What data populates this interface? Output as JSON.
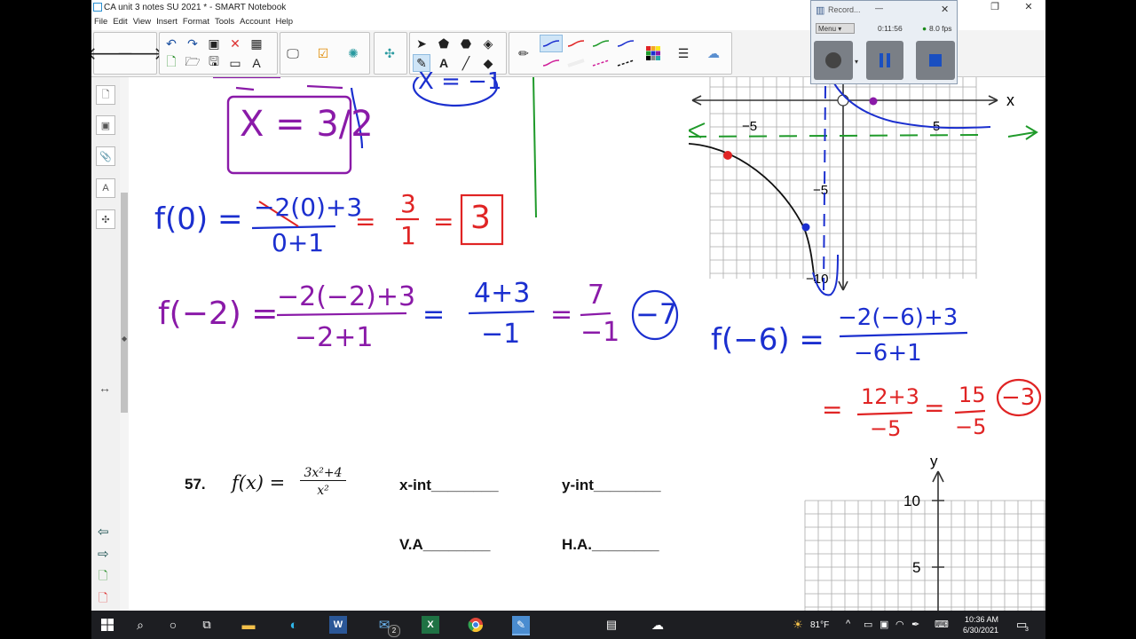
{
  "window": {
    "title": "CA unit 3 notes SU 2021 * - SMART Notebook",
    "menu": [
      "File",
      "Edit",
      "View",
      "Insert",
      "Format",
      "Tools",
      "Account",
      "Help"
    ]
  },
  "recorder": {
    "title": "Record...",
    "menu_label": "Menu",
    "time": "0:11:56",
    "fps": "8.0 fps"
  },
  "page": {
    "problem_number": "57.",
    "function_lhs": "f(x) =",
    "numerator": "3x²+4",
    "denominator": "x²",
    "x_int_label": "x-int________",
    "y_int_label": "y-int________",
    "va_label": "V.A________",
    "ha_label": "H.A.________",
    "graph_top": {
      "x_axis_label": "x",
      "tick_neg5": "−5",
      "tick_pos5": "5",
      "tick_y_neg5": "−5",
      "tick_y_neg10": "−10"
    },
    "graph_bottom": {
      "y_axis_label": "y",
      "tick_10": "10",
      "tick_5": "5"
    }
  },
  "handwriting": {
    "x_result": "X = 3/2",
    "f0_lhs": "f(0) =",
    "f0_num": "−2(0)+3",
    "f0_den": "0+1",
    "f0_mid": "=",
    "f0_frac_num": "3",
    "f0_frac_den": "1",
    "f0_answer": "3",
    "fm2_lhs": "f(−2) =",
    "fm2_num": "−2(−2)+3",
    "fm2_den": "−2+1",
    "fm2_frac1_num": "4+3",
    "fm2_frac1_den": "−1",
    "fm2_frac2_num": "7",
    "fm2_frac2_den": "−1",
    "fm2_answer": "−7",
    "fm6_lhs": "f(−6) =",
    "fm6_num": "−2(−6)+3",
    "fm6_den": "−6+1",
    "fm6_frac1_num": "12+3",
    "fm6_frac1_den": "−5",
    "fm6_frac2_num": "15",
    "fm6_frac2_den": "−5",
    "fm6_answer": "−3",
    "partial_top": "X = −1"
  },
  "taskbar": {
    "weather": "81°F",
    "time": "10:36 AM",
    "date": "6/30/2021",
    "notifications": "3",
    "mail_badge": "2"
  },
  "colors": {
    "ink_blue": "#1b2fcf",
    "ink_purple": "#8a1aa8",
    "ink_red": "#e02424",
    "ink_green": "#1f9a2a",
    "selection": "#cfe5f7"
  }
}
